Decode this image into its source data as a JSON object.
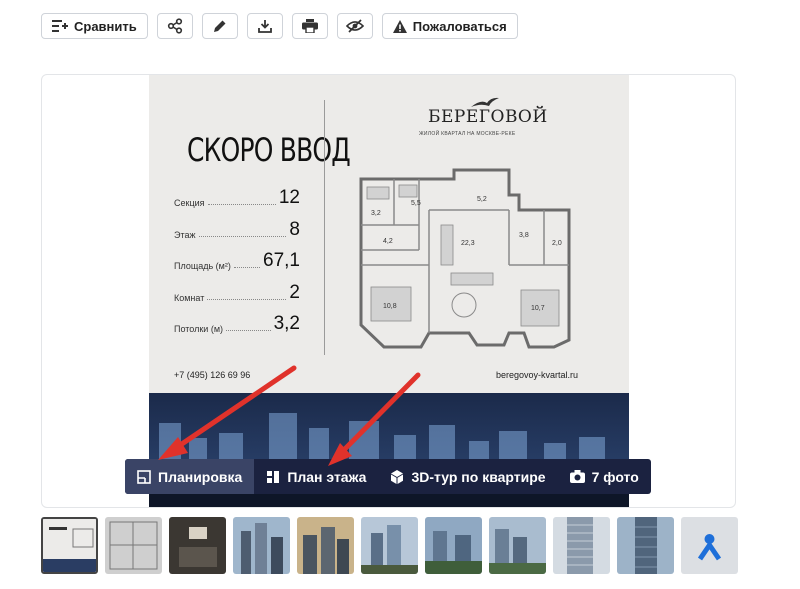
{
  "toolbar": {
    "compare_label": "Сравнить",
    "complain_label": "Пожаловаться"
  },
  "poster": {
    "headline": "СКОРО ВВОД",
    "specs": [
      {
        "label": "Секция",
        "value": "12"
      },
      {
        "label": "Этаж",
        "value": "8"
      },
      {
        "label": "Площадь (м²)",
        "value": "67,1"
      },
      {
        "label": "Комнат",
        "value": "2"
      },
      {
        "label": "Потолки (м)",
        "value": "3,2"
      }
    ],
    "phone": "+7 (495) 126 69 96",
    "site": "beregovoy-kvartal.ru",
    "brand": "БЕРЕГОВОЙ",
    "brand_subtitle": "ЖИЛОЙ КВАРТАЛ НА МОСКВЕ-РЕКЕ",
    "rooms": [
      "5,5",
      "5,2",
      "3,2",
      "4,2",
      "22,3",
      "3,8",
      "2,0",
      "10,8",
      "10,7"
    ]
  },
  "view_tabs": [
    {
      "label": "Планировка",
      "icon": "floorplan-icon",
      "active": true
    },
    {
      "label": "План этажа",
      "icon": "floor-plan-icon",
      "active": false
    },
    {
      "label": "3D-тур по квартире",
      "icon": "cube-icon",
      "active": false
    },
    {
      "label": "7 фото",
      "icon": "camera-icon",
      "active": false
    }
  ],
  "colors": {
    "tabs_bg": "#1b2240",
    "arrow": "#e0322b",
    "accent_blue": "#1e6fd9"
  }
}
